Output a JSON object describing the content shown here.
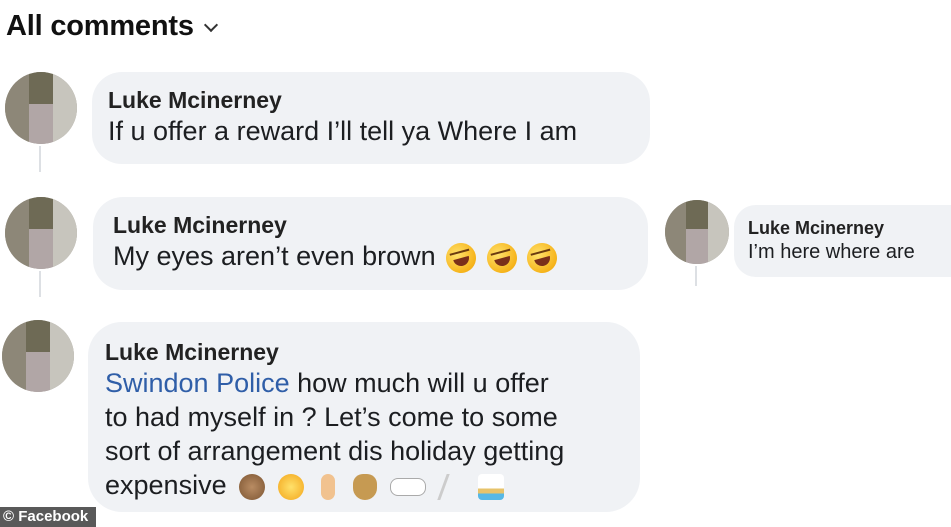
{
  "header": {
    "title": "All comments",
    "dropdown_icon": "chevron-down-icon"
  },
  "comments": [
    {
      "author": "Luke Mcinerney",
      "text": "If u offer a reward I’ll tell ya Where I am"
    },
    {
      "author": "Luke Mcinerney",
      "text": "My eyes aren’t even brown",
      "emojis": [
        "rolling-on-floor-laughing-icon",
        "rolling-on-floor-laughing-icon",
        "rolling-on-floor-laughing-icon"
      ]
    },
    {
      "author": "Luke Mcinerney",
      "mention": "Swindon Police",
      "lines": [
        " how much will u offer",
        "to had myself in ? Let’s come to some",
        "sort of arrangement dis holiday getting",
        "expensive"
      ],
      "emojis": [
        "see-no-evil-monkey-icon",
        "winking-tongue-face-icon",
        "pointing-finger-icon",
        "money-bag-icon",
        "eyes-icon",
        "running-person-icon",
        "desert-island-icon"
      ]
    }
  ],
  "side_comment": {
    "author": "Luke Mcinerney",
    "text": "I’m here where are"
  },
  "credit": "© Facebook"
}
